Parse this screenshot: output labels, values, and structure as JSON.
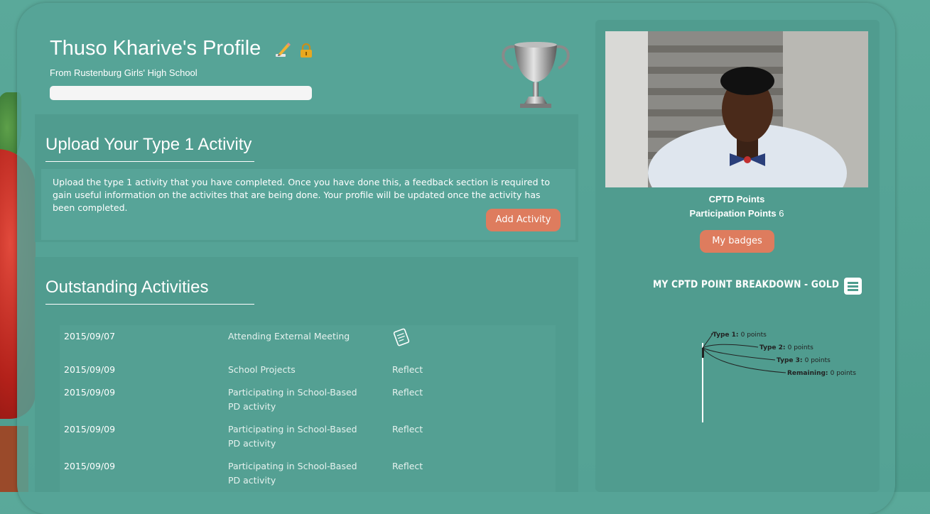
{
  "profile": {
    "title": "Thuso Kharive's Profile",
    "school": "From Rustenburg Girls' High School",
    "progress_fraction": 0
  },
  "icons": {
    "edit": "pencil-icon",
    "lock": "lock-icon",
    "trophy": "trophy-icon",
    "note": "note-icon",
    "menu": "menu-icon"
  },
  "upload": {
    "title": "Upload Your Type 1 Activity",
    "description": "Upload the type 1 activity that you have completed. Once you have done this, a feedback section is required to gain useful information on the activites that are being done. Your profile will be updated once the activity has been completed.",
    "button_label": "Add Activity"
  },
  "outstanding": {
    "title": "Outstanding Activities",
    "rows": [
      {
        "date": "2015/09/07",
        "name": "Attending External Meeting",
        "action": ""
      },
      {
        "date": "2015/09/09",
        "name": "School Projects",
        "action": "Reflect"
      },
      {
        "date": "2015/09/09",
        "name": "Participating in School-Based PD activity",
        "action": "Reflect"
      },
      {
        "date": "2015/09/09",
        "name": "Participating in School-Based PD activity",
        "action": "Reflect"
      },
      {
        "date": "2015/09/09",
        "name": "Participating in School-Based PD activity",
        "action": "Reflect"
      }
    ]
  },
  "sidebar": {
    "cptd_label": "CPTD Points",
    "participation_label": "Participation Points",
    "participation_value": "6",
    "badges_button": "My badges"
  },
  "chart_data": {
    "type": "pie",
    "title": "MY CPTD POINT BREAKDOWN - GOLD",
    "slices": [
      {
        "name": "Type 1",
        "value": 0,
        "value_text": "0 points"
      },
      {
        "name": "Type 2",
        "value": 0,
        "value_text": "0 points"
      },
      {
        "name": "Type 3",
        "value": 0,
        "value_text": "0 points"
      },
      {
        "name": "Remaining",
        "value": 0,
        "value_text": "0 points"
      }
    ]
  }
}
